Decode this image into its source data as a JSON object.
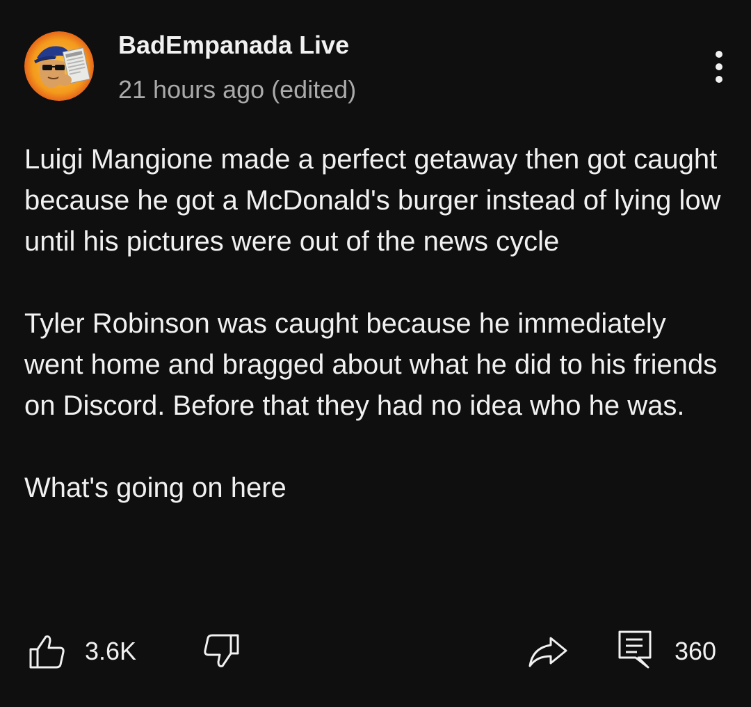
{
  "comment": {
    "author": "BadEmpanada Live",
    "timestamp": "21 hours ago (edited)",
    "paragraphs": [
      "Luigi Mangione made a perfect getaway then got caught because he got a McDonald's burger instead of lying low until his pictures were out of the news cycle",
      "Tyler Robinson was caught because he immediately went home and bragged about what he did to his friends on Discord. Before that they had no idea who he was.",
      "What's going on here"
    ]
  },
  "actions": {
    "like_count": "3.6K",
    "reply_count": "360",
    "icons": {
      "like": "thumbs-up-icon",
      "dislike": "thumbs-down-icon",
      "share": "share-arrow-icon",
      "reply": "comment-icon",
      "more": "more-vertical-icon"
    }
  },
  "colors": {
    "background": "#0f0f0f",
    "primary_text": "#f1f1f1",
    "secondary_text": "#aaaaaa",
    "avatar_ring": "#f59a1a"
  }
}
